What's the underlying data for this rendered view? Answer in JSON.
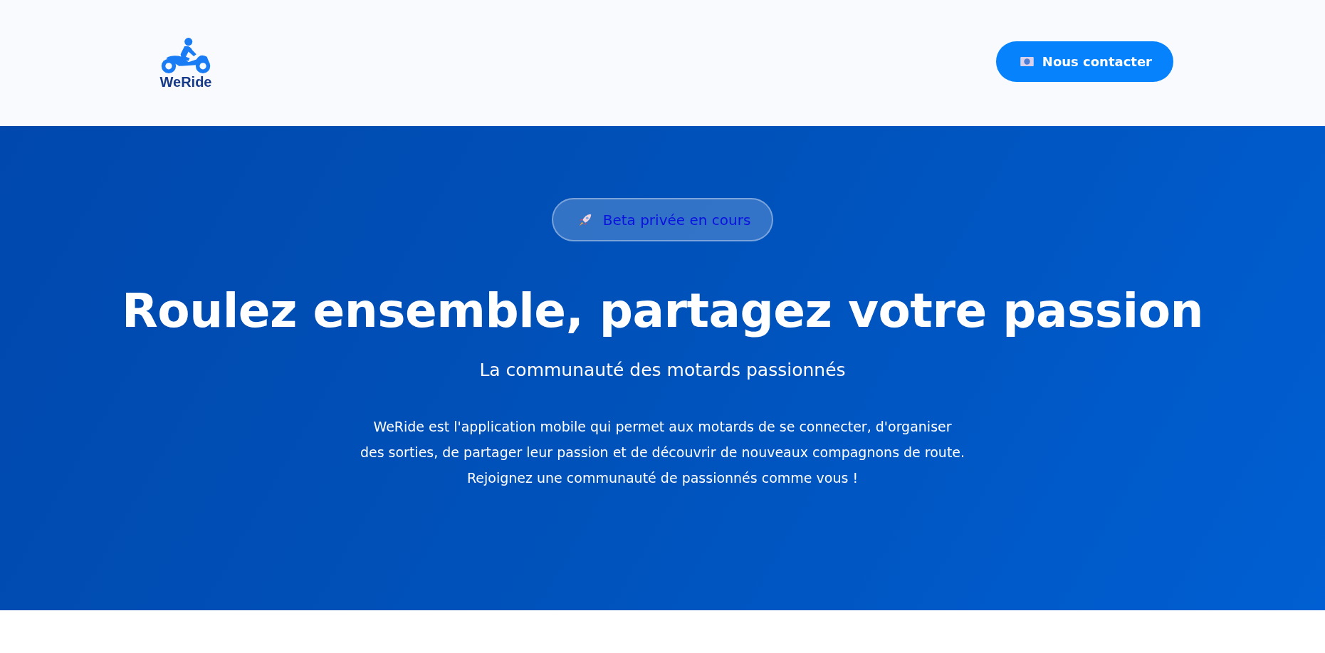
{
  "header": {
    "logo_text": "WeRide",
    "contact_button": "Nous contacter"
  },
  "hero": {
    "badge": "Beta privée en cours",
    "title": "Roulez ensemble, partagez votre passion",
    "subtitle": "La communauté des motards passionnés",
    "description": "WeRide est l'application mobile qui permet aux motards de se connecter, d'organiser des sorties, de partager leur passion et de découvrir de nouveaux compagnons de route. Rejoignez une communauté de passionnés comme vous !"
  }
}
